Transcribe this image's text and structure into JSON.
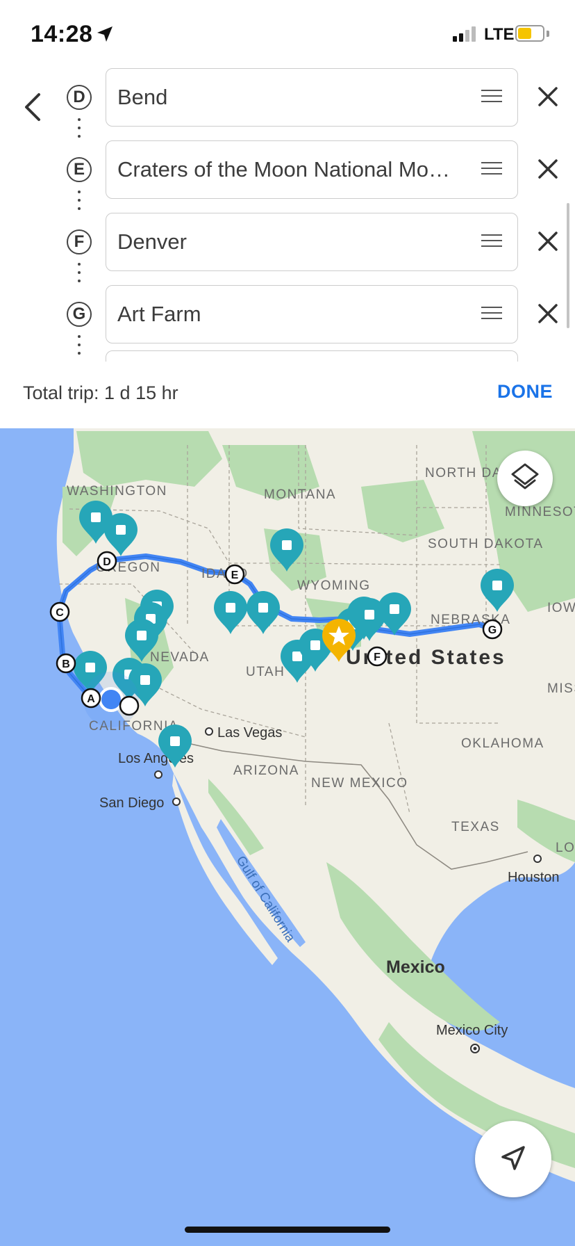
{
  "status_bar": {
    "time": "14:28",
    "network": "LTE",
    "battery_level": 0.55,
    "icons": [
      "location-arrow-icon",
      "signal-icon",
      "battery-icon"
    ]
  },
  "directions": {
    "stops": [
      {
        "letter": "D",
        "name": "Bend"
      },
      {
        "letter": "E",
        "name": "Craters of the Moon National Mon..."
      },
      {
        "letter": "F",
        "name": "Denver"
      },
      {
        "letter": "G",
        "name": "Art Farm"
      }
    ],
    "total_trip": "Total trip: 1 d 15 hr",
    "done_label": "DONE"
  },
  "map": {
    "state_labels": [
      "WASHINGTON",
      "OREGON",
      "IDAHO",
      "MONTANA",
      "WYOMING",
      "NORTH DAKOTA",
      "SOUTH DAKOTA",
      "MINNESOTA",
      "NEBRASKA",
      "IOWA",
      "NEVADA",
      "UTAH",
      "CALIFORNIA",
      "ARIZONA",
      "NEW MEXICO",
      "OKLAHOMA",
      "TEXAS",
      "MISSOURI",
      "LOUISIANA"
    ],
    "country_labels": {
      "us": "United States",
      "mexico": "Mexico"
    },
    "water_labels": [
      "Gulf of California"
    ],
    "city_labels": [
      "Las Vegas",
      "Los Angeles",
      "San Diego",
      "Houston",
      "Mexico City"
    ],
    "route_letters": [
      "A",
      "B",
      "C",
      "D",
      "E",
      "F",
      "G"
    ],
    "colors": {
      "water": "#8ab4f8",
      "land": "#f1efe6",
      "forest": "#b7dcb0",
      "route": "#4285f4",
      "pin": "#26a6b8",
      "star_pin": "#f4b400",
      "done": "#1a73e8"
    }
  }
}
